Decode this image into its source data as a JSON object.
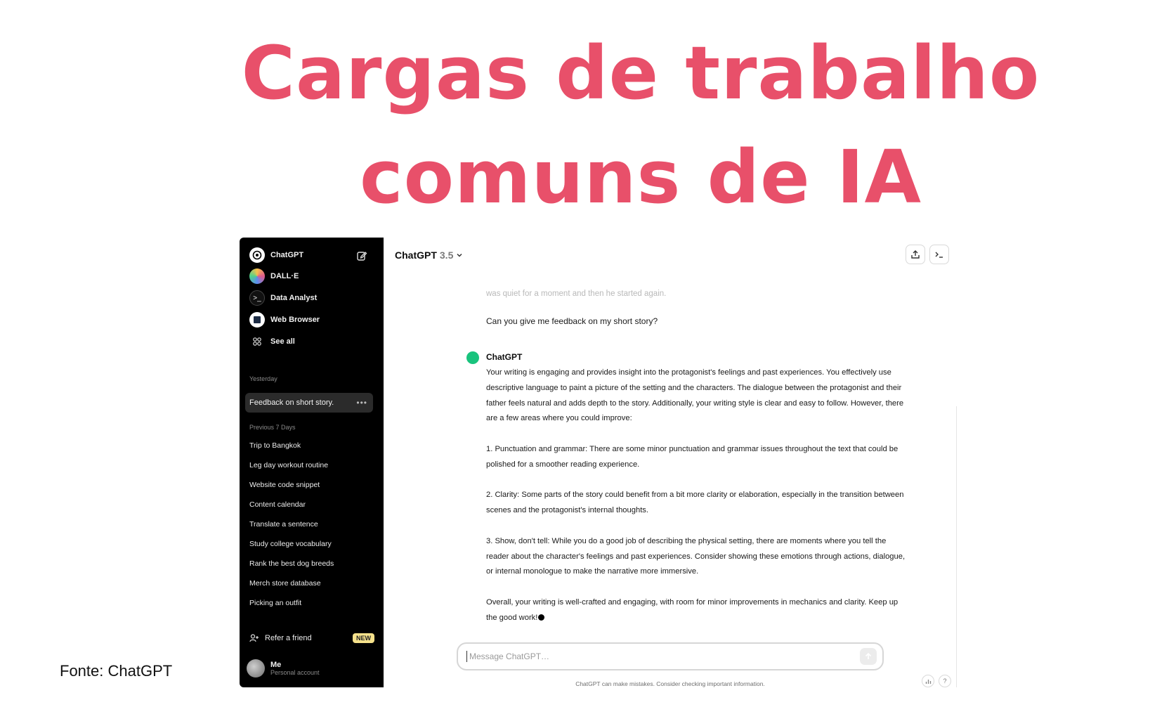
{
  "slide": {
    "title": "Cargas de trabalho comuns de IA",
    "source": "Fonte: ChatGPT"
  },
  "sidebar": {
    "apps": [
      {
        "label": "ChatGPT",
        "icon": "openai-logo-icon"
      },
      {
        "label": "DALL·E",
        "icon": "dalle-icon"
      },
      {
        "label": "Data Analyst",
        "icon": "terminal-icon"
      },
      {
        "label": "Web Browser",
        "icon": "browser-icon"
      },
      {
        "label": "See all",
        "icon": "grid-icon"
      }
    ],
    "section_yesterday": "Yesterday",
    "active_chat": "Feedback on short story.",
    "section_prev7": "Previous 7 Days",
    "history": [
      "Trip to Bangkok",
      "Leg day workout routine",
      "Website code snippet",
      "Content calendar",
      "Translate a sentence",
      "Study college vocabulary",
      "Rank the best dog breeds",
      "Merch store database",
      "Picking an outfit"
    ],
    "refer": "Refer a friend",
    "refer_badge": "NEW",
    "user_name": "Me",
    "user_sub": "Personal account"
  },
  "header": {
    "model": "ChatGPT",
    "version": "3.5"
  },
  "chat": {
    "faded_text": "was quiet for a moment and then he started again.",
    "user_message": "Can you give me feedback on my short story?",
    "assistant_name": "ChatGPT",
    "paragraphs": [
      "Your writing is engaging and provides insight into the protagonist's feelings and past experiences. You effectively use descriptive language to paint a picture of the setting and the characters. The dialogue between the protagonist and their father feels natural and adds depth to the story. Additionally, your writing style is clear and easy to follow. However, there are a few areas where you could improve:",
      "1. Punctuation and grammar: There are some minor punctuation and grammar issues throughout the text that could be polished for a smoother reading experience.",
      "2. Clarity: Some parts of the story could benefit from a bit more clarity or elaboration, especially in the transition between scenes and the protagonist's internal thoughts.",
      "3. Show, don't tell: While you do a good job of describing the physical setting, there are moments where you tell the reader about the character's feelings and past experiences. Consider showing these emotions through actions, dialogue, or internal monologue to make the narrative more immersive.",
      "Overall, your writing is well-crafted and engaging, with room for minor improvements in mechanics and clarity. Keep up the good work!"
    ]
  },
  "composer": {
    "placeholder": "Message ChatGPT…",
    "disclaimer": "ChatGPT can make mistakes. Consider checking important information."
  },
  "colors": {
    "title": "#e8506a",
    "sidebar_bg": "#000000",
    "assistant_avatar": "#19c37d",
    "badge": "#f5e18b"
  }
}
